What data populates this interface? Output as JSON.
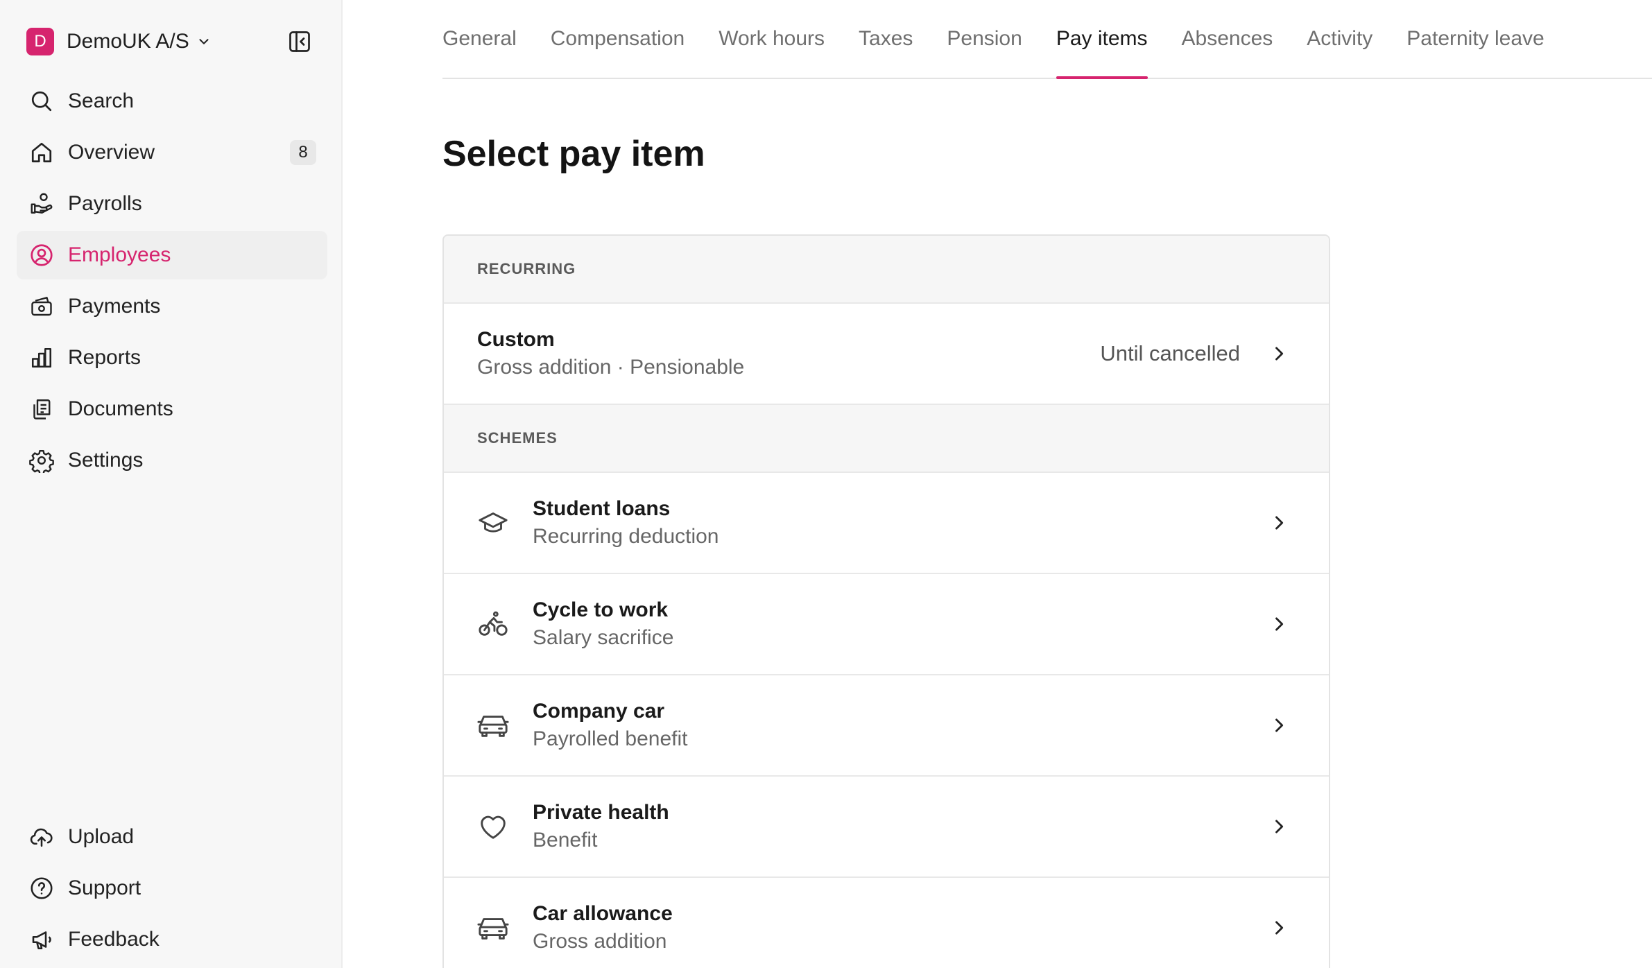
{
  "org": {
    "initial": "D",
    "name": "DemoUK A/S"
  },
  "nav": {
    "items": [
      {
        "label": "Search",
        "icon": "search-icon"
      },
      {
        "label": "Overview",
        "icon": "home-icon",
        "count": "8"
      },
      {
        "label": "Payrolls",
        "icon": "payroll-icon"
      },
      {
        "label": "Employees",
        "icon": "user-circle-icon",
        "active": true
      },
      {
        "label": "Payments",
        "icon": "payments-icon"
      },
      {
        "label": "Reports",
        "icon": "bar-chart-icon"
      },
      {
        "label": "Documents",
        "icon": "documents-icon"
      },
      {
        "label": "Settings",
        "icon": "gear-icon"
      }
    ],
    "bottom": [
      {
        "label": "Upload",
        "icon": "cloud-upload-icon"
      },
      {
        "label": "Support",
        "icon": "help-circle-icon"
      },
      {
        "label": "Feedback",
        "icon": "megaphone-icon"
      }
    ]
  },
  "tabs": [
    {
      "label": "General"
    },
    {
      "label": "Compensation"
    },
    {
      "label": "Work hours"
    },
    {
      "label": "Taxes"
    },
    {
      "label": "Pension"
    },
    {
      "label": "Pay items",
      "active": true
    },
    {
      "label": "Absences"
    },
    {
      "label": "Activity"
    },
    {
      "label": "Paternity leave"
    }
  ],
  "page": {
    "title": "Select pay item"
  },
  "sections": {
    "recurring": {
      "heading": "RECURRING",
      "items": [
        {
          "title": "Custom",
          "subtitle": "Gross addition · Pensionable",
          "right": "Until cancelled"
        }
      ]
    },
    "schemes": {
      "heading": "SCHEMES",
      "items": [
        {
          "title": "Student loans",
          "subtitle": "Recurring deduction",
          "icon": "graduation-cap-icon"
        },
        {
          "title": "Cycle to work",
          "subtitle": "Salary sacrifice",
          "icon": "cyclist-icon"
        },
        {
          "title": "Company car",
          "subtitle": "Payrolled benefit",
          "icon": "car-icon"
        },
        {
          "title": "Private health",
          "subtitle": "Benefit",
          "icon": "heart-icon"
        },
        {
          "title": "Car allowance",
          "subtitle": "Gross addition",
          "icon": "car-icon"
        }
      ]
    }
  },
  "colors": {
    "accent": "#d6246e",
    "sidebar_bg": "#f7f7f7",
    "section_bg": "#f6f6f6"
  }
}
